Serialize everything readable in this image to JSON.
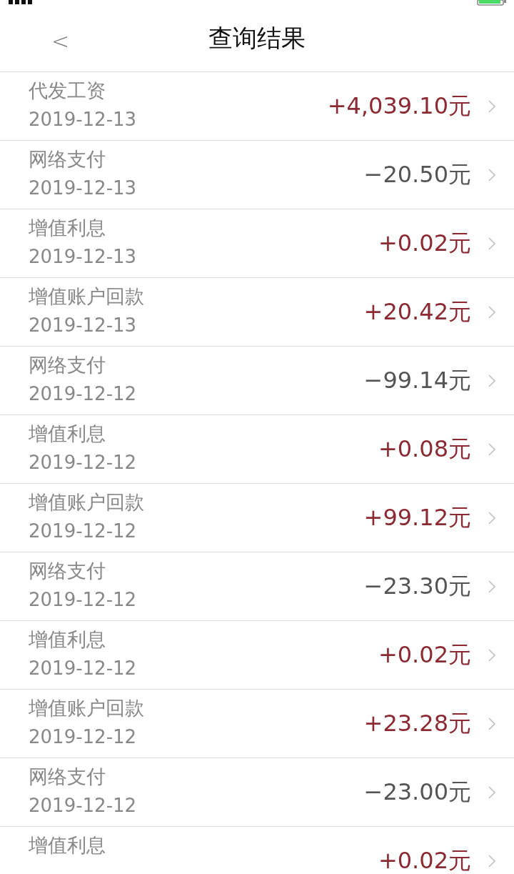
{
  "header": {
    "back": "<",
    "title": "查询结果"
  },
  "transactions": [
    {
      "name": "代发工资",
      "date": "2019-12-13",
      "amount": "+4,039.10元",
      "kind": "credit"
    },
    {
      "name": "网络支付",
      "date": "2019-12-13",
      "amount": "−20.50元",
      "kind": "debit"
    },
    {
      "name": "增值利息",
      "date": "2019-12-13",
      "amount": "+0.02元",
      "kind": "credit"
    },
    {
      "name": "增值账户回款",
      "date": "2019-12-13",
      "amount": "+20.42元",
      "kind": "credit"
    },
    {
      "name": "网络支付",
      "date": "2019-12-12",
      "amount": "−99.14元",
      "kind": "debit"
    },
    {
      "name": "增值利息",
      "date": "2019-12-12",
      "amount": "+0.08元",
      "kind": "credit"
    },
    {
      "name": "增值账户回款",
      "date": "2019-12-12",
      "amount": "+99.12元",
      "kind": "credit"
    },
    {
      "name": "网络支付",
      "date": "2019-12-12",
      "amount": "−23.30元",
      "kind": "debit"
    },
    {
      "name": "增值利息",
      "date": "2019-12-12",
      "amount": "+0.02元",
      "kind": "credit"
    },
    {
      "name": "增值账户回款",
      "date": "2019-12-12",
      "amount": "+23.28元",
      "kind": "credit"
    },
    {
      "name": "网络支付",
      "date": "2019-12-12",
      "amount": "−23.00元",
      "kind": "debit"
    },
    {
      "name": "增值利息",
      "amount": "+0.02元",
      "kind": "credit"
    }
  ]
}
